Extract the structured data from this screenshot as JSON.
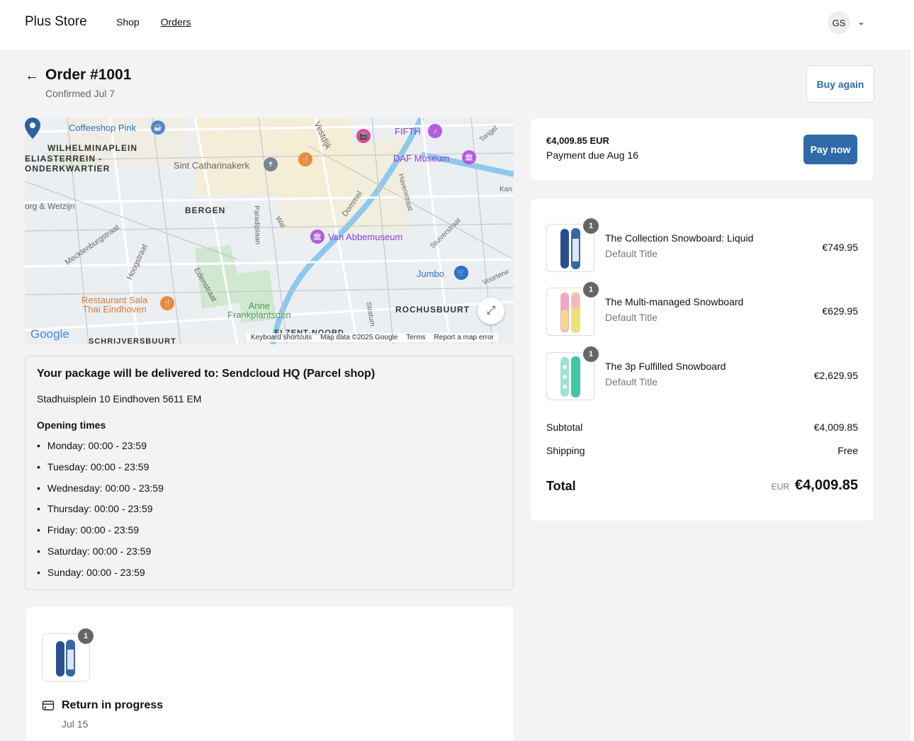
{
  "header": {
    "brand": "Plus Store",
    "nav": [
      "Shop",
      "Orders"
    ],
    "avatar_initials": "GS"
  },
  "order": {
    "title": "Order #1001",
    "confirmed": "Confirmed Jul 7",
    "buy_again": "Buy again"
  },
  "map": {
    "labels": {
      "coffeeshop": "Coffeeshop Pink",
      "wilhelminaplein": "WILHELMINAPLEIN",
      "eliasterrein": "ELIASTERREIN -",
      "onderkwartier": "ONDERKWARTIER",
      "sint_catharinakerk": "Sint Catharinakerk",
      "vestdijk": "Vestdijk",
      "fifth": "FIFTH",
      "daf_museum": "DAF Museum",
      "org_welzijn": "org & Welzijn",
      "bergen": "BERGEN",
      "mecklenburgstraat": "Mecklenburgstraat",
      "hoogstraat": "Hoogstraat",
      "paradijslaan": "Paradijslaan",
      "wal": "Wal",
      "dommel": "Dommel",
      "havenstraat": "Havenstraat",
      "van_abbemuseum": "Van Abbemuseum",
      "stuiverstraat": "Stuiverstraat",
      "jumbo": "Jumbo",
      "voorterw": "Voorterw",
      "restaurant": "Restaurant Sala",
      "restaurant2": "Thai Eindhoven",
      "edenstraat": "Edenstraat",
      "anne": "Anne",
      "frankplantsoen": "Frankplantsoen",
      "stratum": "Stratum",
      "rochusbuurt": "ROCHUSBUURT",
      "schrijversbuurt": "SCHRIJVERSBUURT",
      "elzent_noord": "ELZENT-NOORD",
      "kan": "Kan",
      "tongel": "Tongel"
    },
    "google": "Google",
    "footer": [
      "Keyboard shortcuts",
      "Map data ©2025 Google",
      "Terms",
      "Report a map error"
    ]
  },
  "delivery": {
    "heading": "Your package will be delivered to: Sendcloud HQ (Parcel shop)",
    "address": "Stadhuisplein 10 Eindhoven 5611 EM",
    "opening_label": "Opening times",
    "hours": [
      "Monday: 00:00 - 23:59",
      "Tuesday: 00:00 - 23:59",
      "Wednesday: 00:00 - 23:59",
      "Thursday: 00:00 - 23:59",
      "Friday: 00:00 - 23:59",
      "Saturday: 00:00 - 23:59",
      "Sunday: 00:00 - 23:59"
    ]
  },
  "return": {
    "quantity": "1",
    "status": "Return in progress",
    "date": "Jul 15"
  },
  "payment": {
    "amount": "€4,009.85 EUR",
    "due": "Payment due Aug 16",
    "pay_now": "Pay now"
  },
  "items": [
    {
      "name": "The Collection Snowboard: Liquid",
      "variant": "Default Title",
      "price": "€749.95",
      "quantity": "1"
    },
    {
      "name": "The Multi-managed Snowboard",
      "variant": "Default Title",
      "price": "€629.95",
      "quantity": "1"
    },
    {
      "name": "The 3p Fulfilled Snowboard",
      "variant": "Default Title",
      "price": "€2,629.95",
      "quantity": "1"
    }
  ],
  "totals": {
    "subtotal_label": "Subtotal",
    "subtotal": "€4,009.85",
    "shipping_label": "Shipping",
    "shipping": "Free",
    "total_label": "Total",
    "currency": "EUR",
    "total": "€4,009.85"
  },
  "colors": {
    "accent": "#2f6aa8",
    "badge": "#666666",
    "background": "#f3f3f3"
  }
}
